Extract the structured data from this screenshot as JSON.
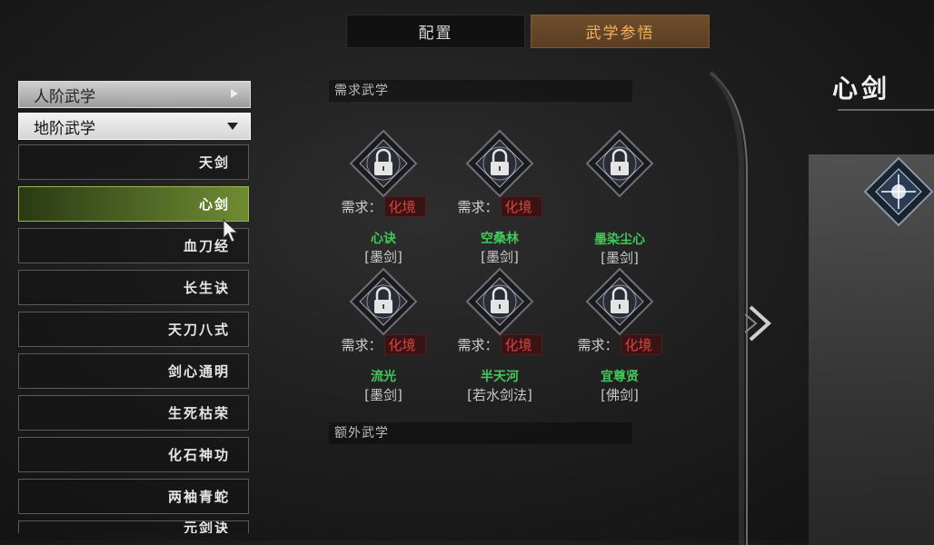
{
  "tabs": {
    "config": "配置",
    "learn": "武学参悟"
  },
  "categories": {
    "human": "人阶武学",
    "earth": "地阶武学"
  },
  "skills_list": [
    "天剑",
    "心剑",
    "血刀经",
    "长生诀",
    "天刀八式",
    "剑心通明",
    "生死枯荣",
    "化石神功",
    "两袖青蛇",
    "元剑诀"
  ],
  "selected_index": 1,
  "sections": {
    "required": "需求武学",
    "extra": "额外武学"
  },
  "required_skills": [
    {
      "req_label": "需求：",
      "req_value": "化境",
      "name": "心诀",
      "school": "[墨剑]",
      "icon": "lock-icon"
    },
    {
      "req_label": "需求：",
      "req_value": "化境",
      "name": "空桑林",
      "school": "[墨剑]",
      "icon": "lock-icon"
    },
    {
      "req_label": "",
      "req_value": "",
      "name": "墨染尘心",
      "school": "[墨剑]",
      "icon": "lock-icon"
    },
    {
      "req_label": "需求：",
      "req_value": "化境",
      "name": "流光",
      "school": "[墨剑]",
      "icon": "lock-icon"
    },
    {
      "req_label": "需求：",
      "req_value": "化境",
      "name": "半天河",
      "school": "[若水剑法]",
      "icon": "lock-icon"
    },
    {
      "req_label": "需求：",
      "req_value": "化境",
      "name": "宜尊贤",
      "school": "[佛剑]",
      "icon": "lock-icon"
    }
  ],
  "detail": {
    "title": "心剑"
  },
  "colors": {
    "accent": "#f2b25c",
    "green": "#43c85a",
    "red": "#e04040"
  }
}
